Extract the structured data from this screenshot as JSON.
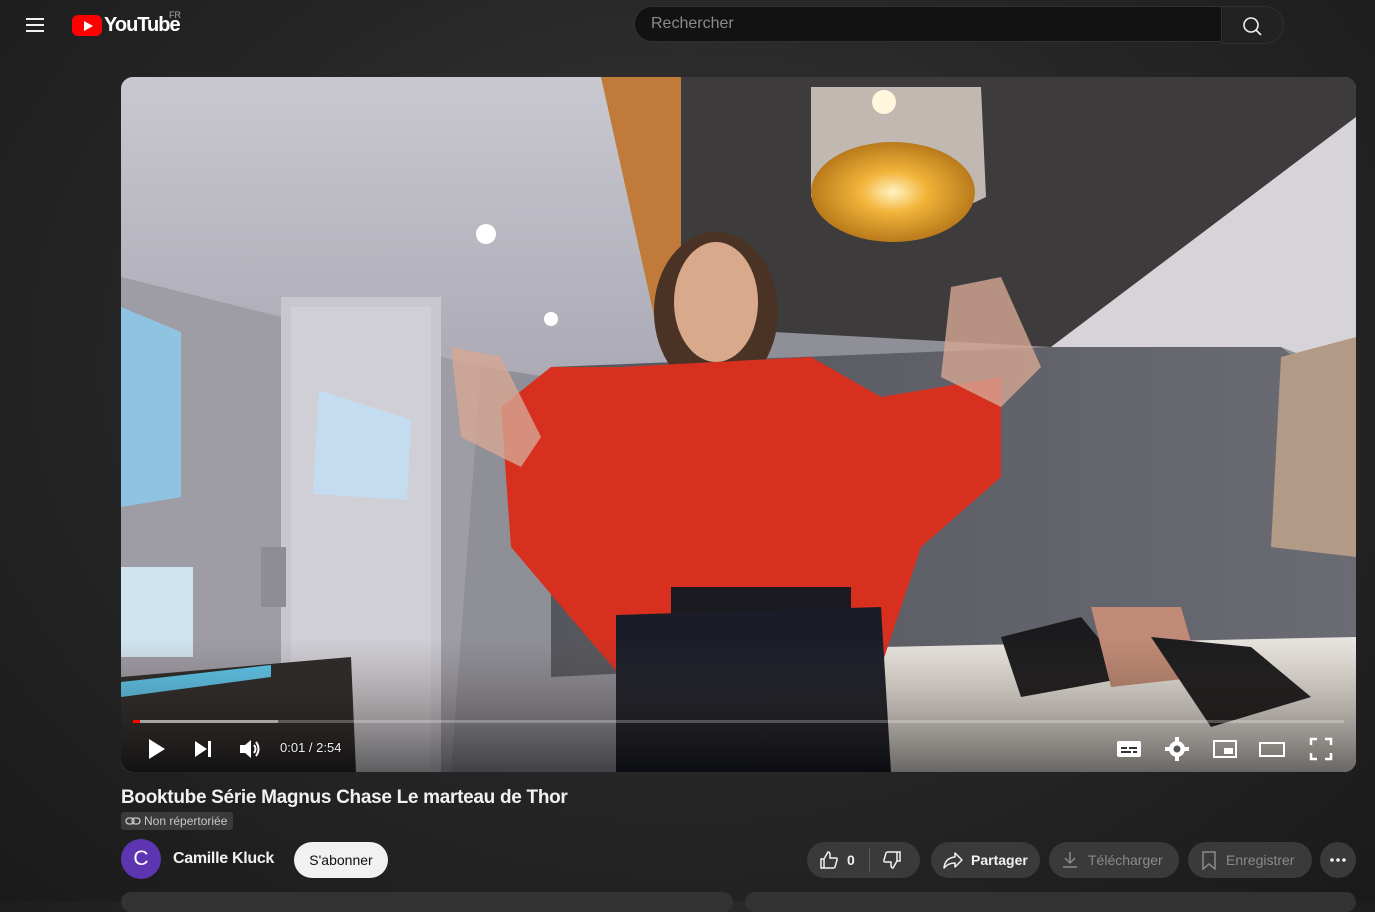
{
  "header": {
    "logo_text": "YouTube",
    "country_code": "FR",
    "search_placeholder": "Rechercher"
  },
  "player": {
    "current_time": "0:01",
    "duration": "2:54",
    "time_display": "0:01 / 2:54",
    "progress_fraction": 0.006,
    "buffered_fraction": 0.12,
    "progress_color": "#ff0000"
  },
  "video": {
    "title": "Booktube Série Magnus Chase Le marteau de Thor",
    "visibility_badge": "Non répertoriée"
  },
  "channel": {
    "avatar_letter": "C",
    "avatar_color": "#5e35b1",
    "name": "Camille Kluck",
    "subscribe_label": "S'abonner"
  },
  "actions": {
    "like_count": "0",
    "share_label": "Partager",
    "download_label": "Télécharger",
    "save_label": "Enregistrer"
  },
  "icons": [
    "menu-icon",
    "youtube-logo-icon",
    "search-icon",
    "play-icon",
    "next-icon",
    "volume-icon",
    "subtitles-icon",
    "settings-icon",
    "miniplayer-icon",
    "theater-icon",
    "fullscreen-icon",
    "link-icon",
    "like-icon",
    "dislike-icon",
    "share-icon",
    "download-icon",
    "bookmark-icon",
    "more-icon"
  ]
}
